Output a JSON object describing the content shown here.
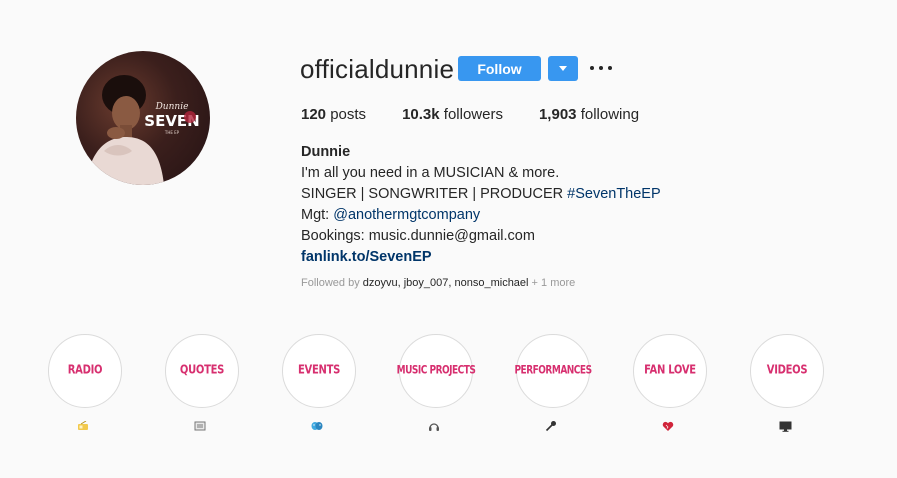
{
  "profile": {
    "username": "officialdunnie",
    "follow_label": "Follow",
    "avatar_text": {
      "artist": "Dunnie",
      "title": "SEVEN",
      "subtitle": "THE EP"
    }
  },
  "stats": {
    "posts_count": "120",
    "posts_label": "posts",
    "followers_count": "10.3k",
    "followers_label": "followers",
    "following_count": "1,903",
    "following_label": "following"
  },
  "bio": {
    "name": "Dunnie",
    "line1": "I'm all you need in a MUSICIAN & more.",
    "line2_prefix": "SINGER | SONGWRITER | PRODUCER ",
    "line2_hashtag": "#SevenTheEP",
    "line3_prefix": "Mgt: ",
    "line3_mention": "@anothermgtcompany",
    "line4": "Bookings: music.dunnie@gmail.com",
    "link": "fanlink.to/SevenEP"
  },
  "followed_by": {
    "prefix": "Followed by ",
    "names": "dzoyvu, jboy_007, nonso_michael",
    "more": " + 1 more"
  },
  "highlights": [
    {
      "label": "RADIO",
      "icon": "radio-icon",
      "icon_color": "#f2c94c"
    },
    {
      "label": "QUOTES",
      "icon": "newspaper-icon",
      "icon_color": "#777777"
    },
    {
      "label": "EVENTS",
      "icon": "theater-masks-icon",
      "icon_color": "#3fa9e0"
    },
    {
      "label": "MUSIC PROJECTS",
      "icon": "headphones-icon",
      "icon_color": "#555555"
    },
    {
      "label": "PERFORMANCES",
      "icon": "microphone-icon",
      "icon_color": "#333333"
    },
    {
      "label": "FAN LOVE",
      "icon": "heart-icon",
      "icon_color": "#d0243a"
    },
    {
      "label": "VIDEOS",
      "icon": "tv-icon",
      "icon_color": "#333333"
    }
  ],
  "colors": {
    "accent": "#3897f0",
    "highlight_text": "#d72f6f",
    "link": "#003569"
  }
}
